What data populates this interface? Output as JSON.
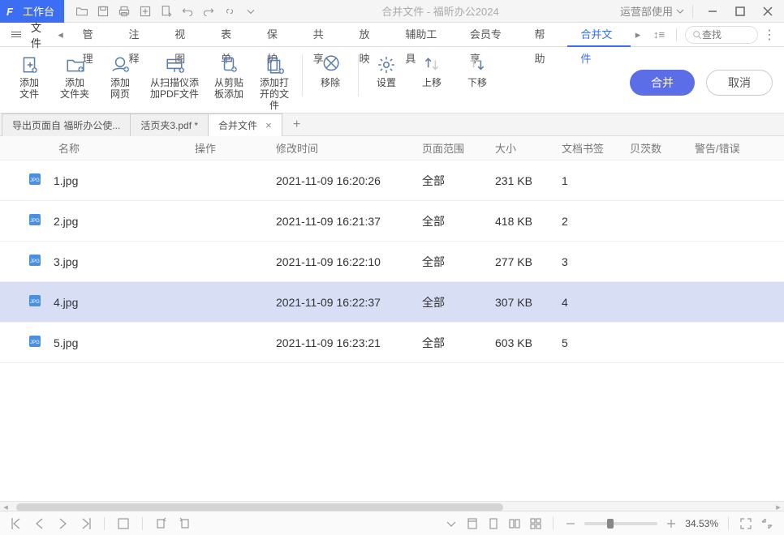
{
  "titlebar": {
    "workspace_label": "工作台",
    "window_title": "合并文件 - 福昕办公2024",
    "usage_label": "运营部使用"
  },
  "menubar": {
    "file_label": "文件",
    "items": [
      "管理",
      "注释",
      "视图",
      "表单",
      "保护",
      "共享",
      "放映",
      "辅助工具",
      "会员专享",
      "帮助",
      "合并文件"
    ],
    "active_index": 10,
    "search_placeholder": "查找"
  },
  "ribbon": {
    "buttons": [
      {
        "label": "添加\n文件"
      },
      {
        "label": "添加\n文件夹"
      },
      {
        "label": "添加\n网页"
      },
      {
        "label": "从扫描仪添\n加PDF文件"
      },
      {
        "label": "从剪贴\n板添加"
      },
      {
        "label": "添加打\n开的文件"
      },
      {
        "label": "移除"
      },
      {
        "label": "设置"
      },
      {
        "label": "上移"
      },
      {
        "label": "下移"
      }
    ],
    "merge_label": "合并",
    "cancel_label": "取消"
  },
  "doctabs": {
    "tabs": [
      {
        "label": "导出页面自 福昕办公使...",
        "closable": false
      },
      {
        "label": "活页夹3.pdf *",
        "closable": false
      },
      {
        "label": "合并文件",
        "closable": true
      }
    ],
    "active_index": 2
  },
  "table": {
    "headers": {
      "name": "名称",
      "op": "操作",
      "time": "修改时间",
      "range": "页面范围",
      "size": "大小",
      "bookmark": "文档书签",
      "pages": "贝茨数",
      "warn": "警告/错误"
    },
    "rows": [
      {
        "name": "1.jpg",
        "time": "2021-11-09 16:20:26",
        "range": "全部",
        "size": "231 KB",
        "bookmark": "1"
      },
      {
        "name": "2.jpg",
        "time": "2021-11-09 16:21:37",
        "range": "全部",
        "size": "418 KB",
        "bookmark": "2"
      },
      {
        "name": "3.jpg",
        "time": "2021-11-09 16:22:10",
        "range": "全部",
        "size": "277 KB",
        "bookmark": "3"
      },
      {
        "name": "4.jpg",
        "time": "2021-11-09 16:22:37",
        "range": "全部",
        "size": "307 KB",
        "bookmark": "4"
      },
      {
        "name": "5.jpg",
        "time": "2021-11-09 16:23:21",
        "range": "全部",
        "size": "603 KB",
        "bookmark": "5"
      }
    ],
    "selected_index": 3
  },
  "statusbar": {
    "zoom_percent": "34.53%"
  }
}
